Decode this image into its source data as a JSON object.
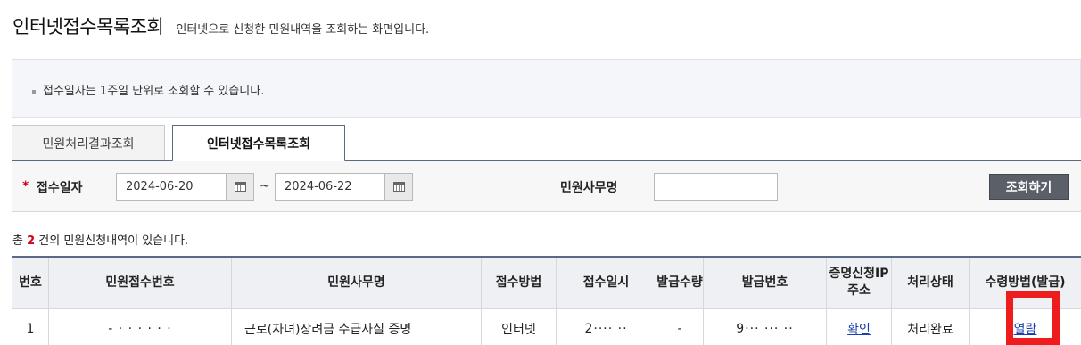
{
  "header": {
    "title": "인터넷접수목록조회",
    "description": "인터넷으로 신청한 민원내역을 조회하는 화면입니다."
  },
  "notice": {
    "text": "접수일자는 1주일 단위로 조회할 수 있습니다."
  },
  "tabs": [
    {
      "label": "민원처리결과조회",
      "active": false
    },
    {
      "label": "인터넷접수목록조회",
      "active": true
    }
  ],
  "search": {
    "required_mark": "*",
    "date_label": "접수일자",
    "date_from": "2024-06-20",
    "date_to": "2024-06-22",
    "range_separator": "~",
    "office_label": "민원사무명",
    "office_value": "",
    "search_button": "조회하기"
  },
  "summary": {
    "prefix": "총",
    "count": "2",
    "suffix": "건의 민원신청내역이 있습니다."
  },
  "table": {
    "headers": {
      "no": "번호",
      "receipt_no": "민원접수번호",
      "office_name": "민원사무명",
      "method": "접수방법",
      "datetime": "접수일시",
      "qty": "발급수량",
      "issue_no": "발급번호",
      "ip": "증명신청IP주소",
      "status": "처리상태",
      "receive": "수령방법(발급)"
    },
    "rows": [
      {
        "no": "1",
        "receipt_no": "- · · · · · ·",
        "office_name": "근로(자녀)장려금 수급사실 증명",
        "method": "인터넷",
        "datetime": "2···· ··",
        "qty": "-",
        "issue_no": "9··· ··· ··",
        "ip": "확인",
        "status": "처리완료",
        "receive": "열람"
      }
    ]
  },
  "colors": {
    "accent_border": "#5a6a85",
    "link": "#1a3fb0",
    "required": "#d0021b",
    "highlight": "#ee1c1c"
  }
}
